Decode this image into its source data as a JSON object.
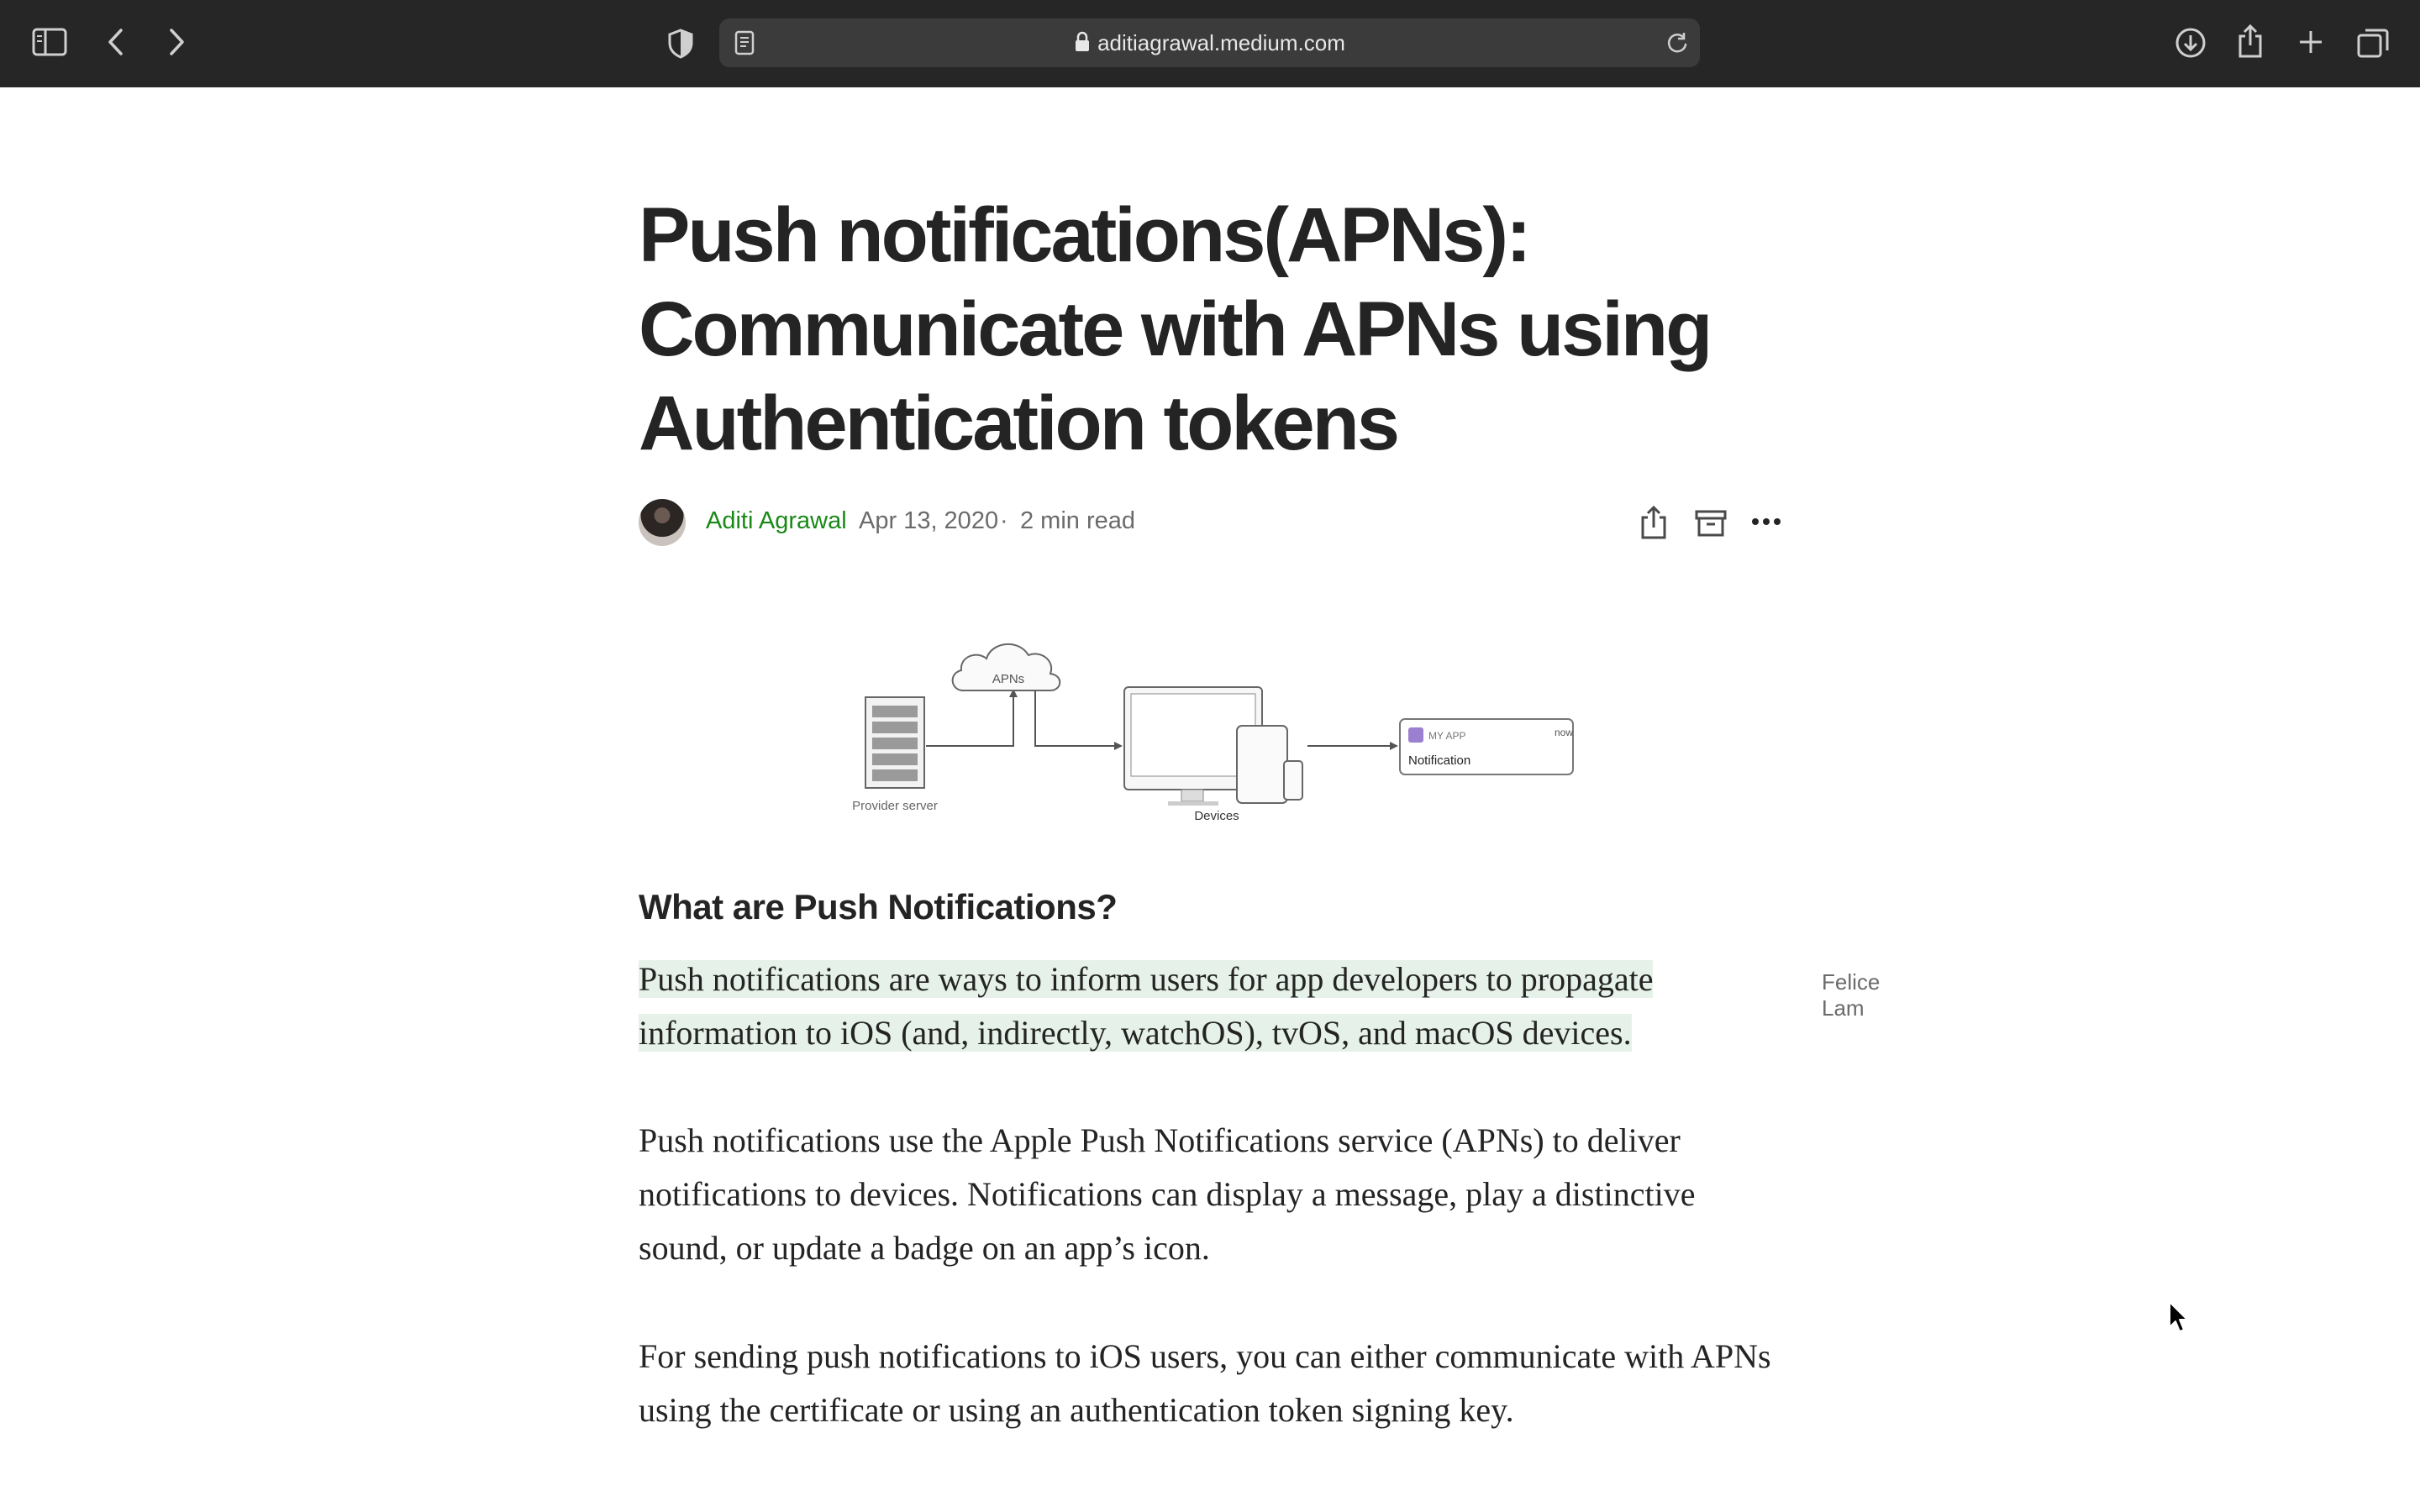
{
  "browser": {
    "url": "aditiagrawal.medium.com"
  },
  "article": {
    "title": "Push notifications(APNs): Communicate with APNs using Authentication tokens",
    "author": "Aditi Agrawal",
    "date": "Apr 13, 2020",
    "separator": "·",
    "read_time": "2 min read",
    "figure": {
      "cloud_label": "APNs",
      "server_label": "Provider server",
      "devices_label": "Devices",
      "notif_app": "MY APP",
      "notif_time": "now",
      "notif_title": "Notification"
    },
    "heading": "What are Push Notifications?",
    "paragraph_1": "Push notifications are ways to inform users for app developers to propagate information to iOS (and, indirectly, watchOS), tvOS, and macOS devices.",
    "paragraph_2": "Push notifications use the Apple Push Notifications service (APNs) to deliver notifications to devices. Notifications can display a message, play a distinctive sound, or update a badge on an app’s icon.",
    "paragraph_3": "For sending push notifications to iOS users, you can either communicate with APNs using the certificate or using an authentication token signing key.",
    "highlight_note": "Felice Lam"
  },
  "colors": {
    "toolbar": "#262626",
    "author_green": "#1a8917",
    "highlight": "#e6f2e9"
  }
}
